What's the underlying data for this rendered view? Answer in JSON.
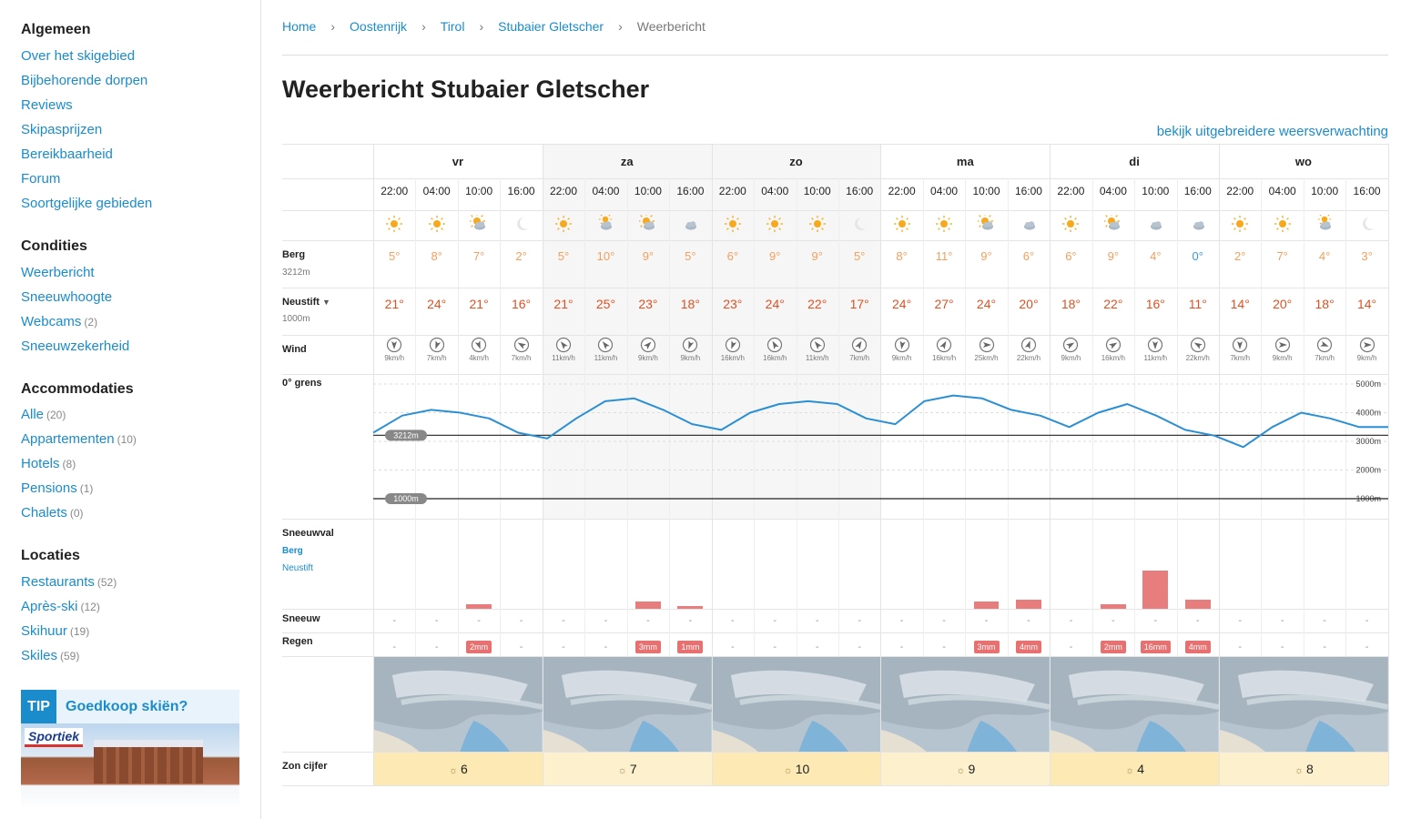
{
  "sidebar": {
    "sections": [
      {
        "title": "Algemeen",
        "items": [
          {
            "label": "Over het skigebied"
          },
          {
            "label": "Bijbehorende dorpen"
          },
          {
            "label": "Reviews"
          },
          {
            "label": "Skipasprijzen"
          },
          {
            "label": "Bereikbaarheid"
          },
          {
            "label": "Forum"
          },
          {
            "label": "Soortgelijke gebieden"
          }
        ]
      },
      {
        "title": "Condities",
        "items": [
          {
            "label": "Weerbericht"
          },
          {
            "label": "Sneeuwhoogte"
          },
          {
            "label": "Webcams",
            "count": "(2)"
          },
          {
            "label": "Sneeuwzekerheid"
          }
        ]
      },
      {
        "title": "Accommodaties",
        "items": [
          {
            "label": "Alle",
            "count": "(20)"
          },
          {
            "label": "Appartementen",
            "count": "(10)"
          },
          {
            "label": "Hotels",
            "count": "(8)"
          },
          {
            "label": "Pensions",
            "count": "(1)"
          },
          {
            "label": "Chalets",
            "count": "(0)"
          }
        ]
      },
      {
        "title": "Locaties",
        "items": [
          {
            "label": "Restaurants",
            "count": "(52)"
          },
          {
            "label": "Après-ski",
            "count": "(12)"
          },
          {
            "label": "Skihuur",
            "count": "(19)"
          },
          {
            "label": "Skiles",
            "count": "(59)"
          }
        ]
      }
    ],
    "tip": {
      "badge": "TIP",
      "title": "Goedkoop skiën?",
      "logo": "Sportiek"
    }
  },
  "breadcrumb": [
    "Home",
    "Oostenrijk",
    "Tirol",
    "Stubaier Gletscher",
    "Weerbericht"
  ],
  "page_title": "Weerbericht Stubaier Gletscher",
  "more_link": "bekijk uitgebreidere weersverwachting",
  "labels": {
    "berg": "Berg",
    "berg_alt": "3212m",
    "neustift": "Neustift",
    "neustift_alt": "1000m",
    "wind": "Wind",
    "zero": "0° grens",
    "snowfall": "Sneeuwval",
    "snowfall_berg": "Berg",
    "snowfall_neustift": "Neustift",
    "snow": "Sneeuw",
    "rain": "Regen",
    "zon": "Zon cijfer",
    "pill_top": "3212m",
    "pill_bottom": "1000m",
    "axis": [
      "5000m",
      "4000m",
      "3000m",
      "2000m",
      "1000m"
    ]
  },
  "days": [
    {
      "name": "vr",
      "shaded": false,
      "zon": "6",
      "times": [
        "22:00",
        "04:00",
        "10:00",
        "16:00"
      ],
      "icons": [
        "sun",
        "sun",
        "sun-cloud",
        "moon"
      ],
      "berg": [
        "5°",
        "8°",
        "7°",
        "2°"
      ],
      "neustift": [
        "21°",
        "24°",
        "21°",
        "16°"
      ],
      "wind": [
        "9km/h",
        "7km/h",
        "4km/h",
        "7km/h"
      ],
      "wind_dir": [
        180,
        200,
        160,
        300
      ],
      "snow": [
        "-",
        "-",
        "-",
        "-"
      ],
      "rain": [
        "-",
        "-",
        "2mm",
        "-"
      ]
    },
    {
      "name": "za",
      "shaded": true,
      "zon": "7",
      "times": [
        "22:00",
        "04:00",
        "10:00",
        "16:00"
      ],
      "icons": [
        "sun",
        "cloud-sun",
        "sun-cloud",
        "cloud"
      ],
      "berg": [
        "5°",
        "10°",
        "9°",
        "5°"
      ],
      "neustift": [
        "21°",
        "25°",
        "23°",
        "18°"
      ],
      "wind": [
        "11km/h",
        "11km/h",
        "9km/h",
        "9km/h"
      ],
      "wind_dir": [
        320,
        320,
        45,
        200
      ],
      "snow": [
        "-",
        "-",
        "-",
        "-"
      ],
      "rain": [
        "-",
        "-",
        "3mm",
        "1mm"
      ]
    },
    {
      "name": "zo",
      "shaded": true,
      "zon": "10",
      "times": [
        "22:00",
        "04:00",
        "10:00",
        "16:00"
      ],
      "icons": [
        "sun",
        "sun",
        "sun",
        "moon"
      ],
      "berg": [
        "6°",
        "9°",
        "9°",
        "5°"
      ],
      "neustift": [
        "23°",
        "24°",
        "22°",
        "17°"
      ],
      "wind": [
        "16km/h",
        "16km/h",
        "11km/h",
        "7km/h"
      ],
      "wind_dir": [
        200,
        330,
        320,
        30
      ],
      "snow": [
        "-",
        "-",
        "-",
        "-"
      ],
      "rain": [
        "-",
        "-",
        "-",
        "-"
      ]
    },
    {
      "name": "ma",
      "shaded": false,
      "zon": "9",
      "times": [
        "22:00",
        "04:00",
        "10:00",
        "16:00"
      ],
      "icons": [
        "sun",
        "sun",
        "sun-cloud",
        "cloud"
      ],
      "berg": [
        "8°",
        "11°",
        "9°",
        "6°"
      ],
      "neustift": [
        "24°",
        "27°",
        "24°",
        "20°"
      ],
      "wind": [
        "9km/h",
        "16km/h",
        "25km/h",
        "22km/h"
      ],
      "wind_dir": [
        190,
        30,
        90,
        20
      ],
      "snow": [
        "-",
        "-",
        "-",
        "-"
      ],
      "rain": [
        "-",
        "-",
        "3mm",
        "4mm"
      ]
    },
    {
      "name": "di",
      "shaded": false,
      "zon": "4",
      "times": [
        "22:00",
        "04:00",
        "10:00",
        "16:00"
      ],
      "icons": [
        "sun",
        "sun-cloud",
        "cloud",
        "cloud"
      ],
      "berg": [
        "6°",
        "9°",
        "4°",
        "0°"
      ],
      "neustift": [
        "18°",
        "22°",
        "16°",
        "11°"
      ],
      "wind": [
        "9km/h",
        "16km/h",
        "11km/h",
        "22km/h"
      ],
      "wind_dir": [
        60,
        60,
        180,
        300
      ],
      "snow": [
        "-",
        "-",
        "-",
        "-"
      ],
      "rain": [
        "-",
        "2mm",
        "16mm",
        "4mm"
      ]
    },
    {
      "name": "wo",
      "shaded": false,
      "zon": "8",
      "times": [
        "22:00",
        "04:00",
        "10:00",
        "16:00"
      ],
      "icons": [
        "sun",
        "sun",
        "cloud-sun",
        "moon"
      ],
      "berg": [
        "2°",
        "7°",
        "4°",
        "3°"
      ],
      "neustift": [
        "14°",
        "20°",
        "18°",
        "14°"
      ],
      "wind": [
        "7km/h",
        "9km/h",
        "7km/h",
        "9km/h"
      ],
      "wind_dir": [
        180,
        90,
        110,
        90
      ],
      "snow": [
        "-",
        "-",
        "-",
        "-"
      ],
      "rain": [
        "-",
        "-",
        "-",
        "-"
      ]
    }
  ],
  "freezing_level_m": [
    3300,
    3900,
    4100,
    4000,
    3800,
    3300,
    3100,
    3800,
    4400,
    4500,
    4100,
    3600,
    3400,
    4000,
    4300,
    4400,
    4300,
    3800,
    3600,
    4400,
    4600,
    4500,
    4100,
    3900,
    3500,
    4000,
    4300,
    3900,
    3400,
    3200,
    2800,
    3500,
    4000,
    3800,
    3500,
    3500
  ],
  "snowfall_mm": [
    0,
    0,
    2,
    0,
    0,
    0,
    3,
    1,
    0,
    0,
    0,
    0,
    0,
    0,
    3,
    4,
    0,
    2,
    16,
    4,
    0,
    0,
    0,
    0
  ],
  "colors": {
    "link": "#1a8ccc",
    "mountain_temp": "#f2a05c",
    "valley_temp": "#e05020",
    "cold_temp": "#3a9ad9",
    "bar": "#e77d7d",
    "line": "#2b8fd4",
    "zon_bg": "#fde9b3",
    "zon_bg_alt": "#fdf0cc"
  }
}
